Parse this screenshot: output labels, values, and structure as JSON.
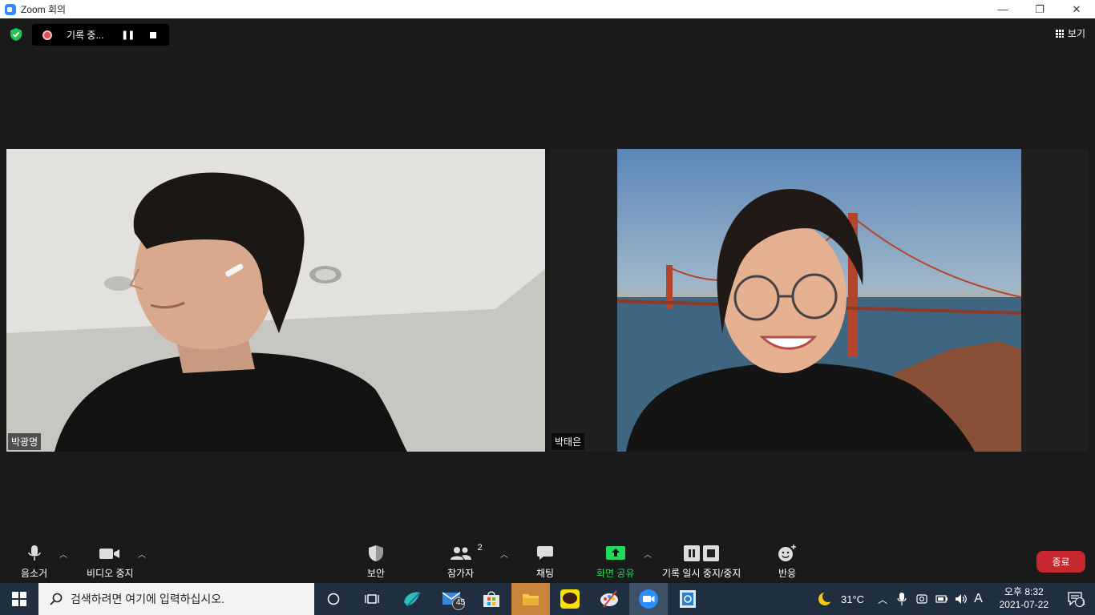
{
  "window": {
    "title": "Zoom 회의",
    "minimize": "—",
    "maximize": "❐",
    "close": "✕"
  },
  "recording": {
    "status": "기록 중...",
    "pause_glyph": "❚❚"
  },
  "view": {
    "label": "보기"
  },
  "participants": [
    {
      "name": "박광명"
    },
    {
      "name": "박태은"
    }
  ],
  "toolbar": {
    "mute": "음소거",
    "video": "비디오 중지",
    "security": "보안",
    "participants": "참가자",
    "participants_count": "2",
    "chat": "채팅",
    "share": "화면 공유",
    "record": "기록 일시 중지/중지",
    "reactions": "반응",
    "end": "종료"
  },
  "taskbar": {
    "search_placeholder": "검색하려면 여기에 입력하십시오.",
    "mail_badge": "45",
    "weather": "31°C",
    "ime": "A",
    "time": "오후 8:32",
    "date": "2021-07-22",
    "notification_count": "1"
  },
  "colors": {
    "share_green": "#23d959",
    "end_red": "#c5272d",
    "taskbar": "#1f2f40",
    "shield_green": "#23c552"
  }
}
